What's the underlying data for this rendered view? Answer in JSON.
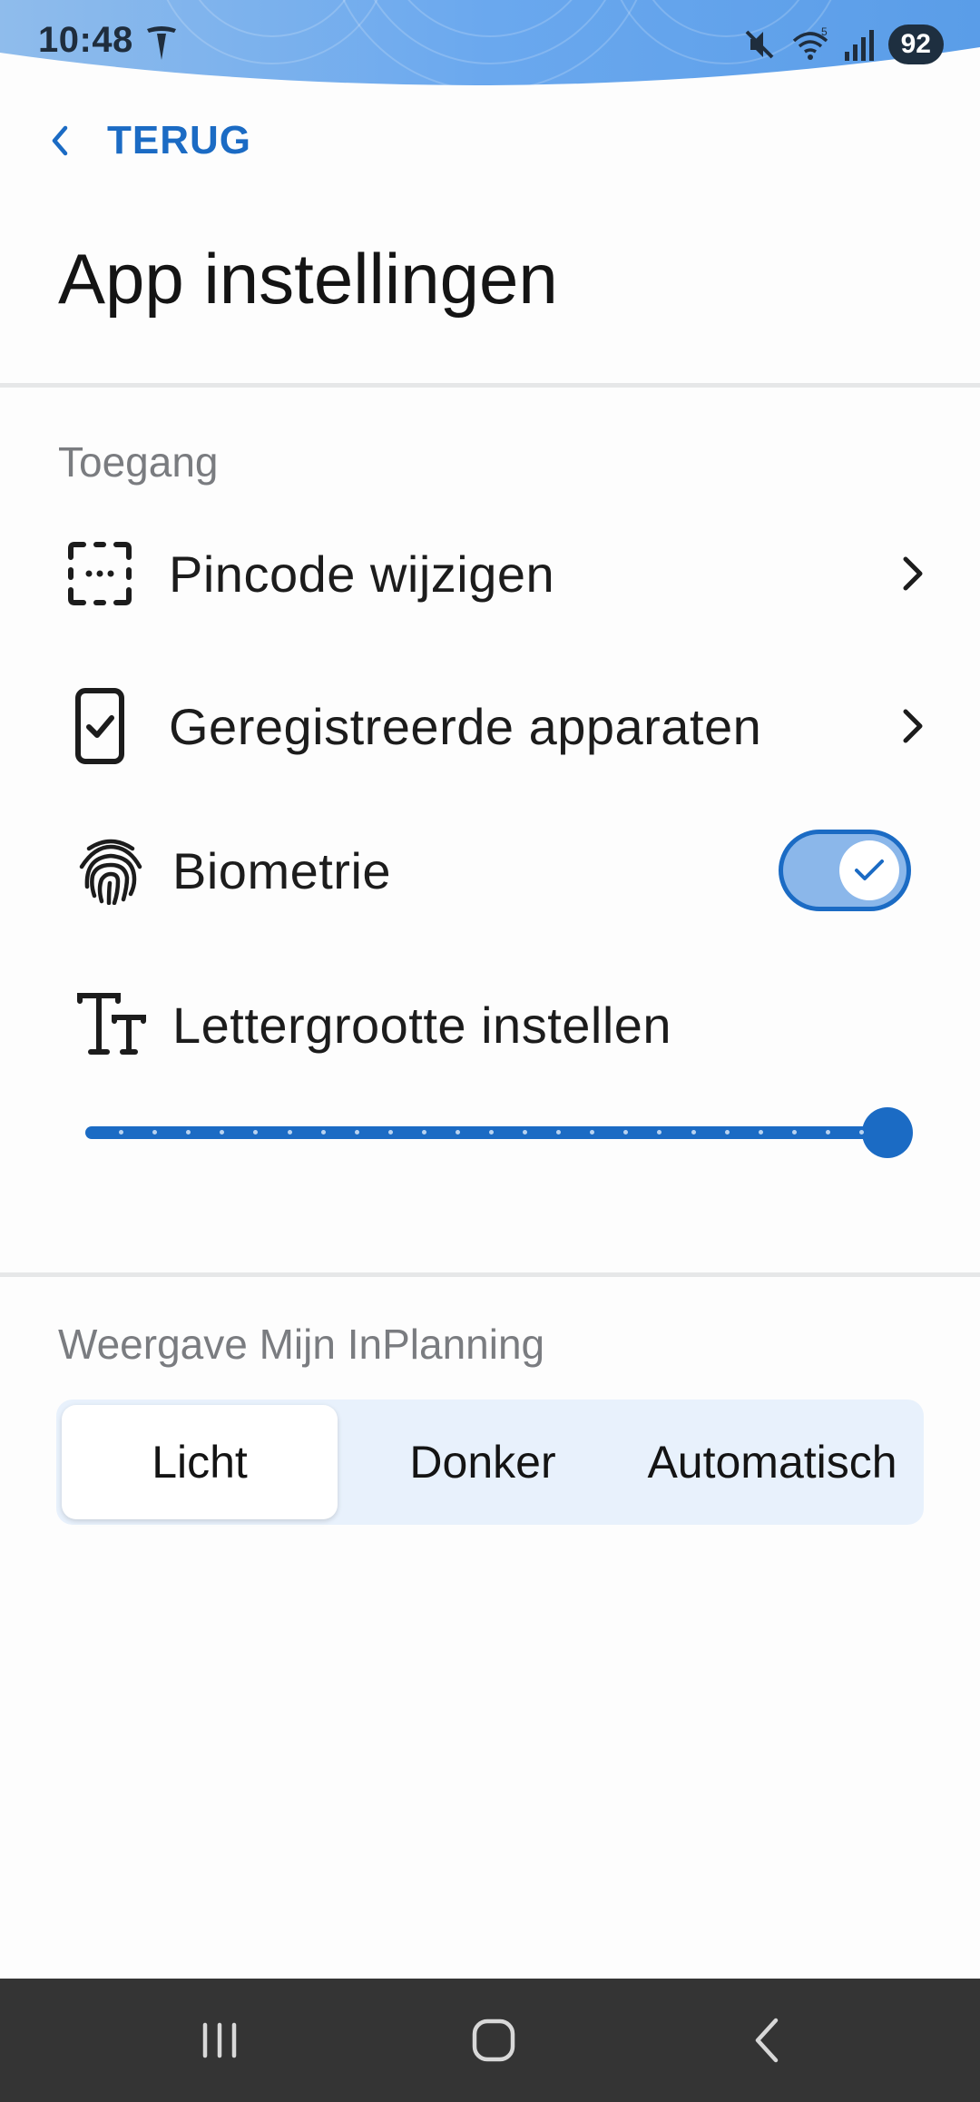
{
  "status_bar": {
    "time": "10:48",
    "battery": "92",
    "icons": [
      "tesla-icon",
      "mute-icon",
      "wifi-icon",
      "signal-icon"
    ]
  },
  "header": {
    "back_label": "TERUG",
    "title": "App instellingen"
  },
  "access": {
    "section_title": "Toegang",
    "items": [
      {
        "label": "Pincode wijzigen",
        "icon": "pincode-icon"
      },
      {
        "label": "Geregistreerde apparaten",
        "icon": "device-check-icon"
      },
      {
        "label": "Biometrie",
        "icon": "fingerprint-icon",
        "toggle_on": true
      },
      {
        "label": "Lettergrootte instellen",
        "icon": "text-size-icon"
      }
    ],
    "font_size_level": 1.0
  },
  "display": {
    "section_title": "Weergave Mijn InPlanning",
    "options": [
      "Licht",
      "Donker",
      "Automatisch"
    ],
    "selected": "Licht"
  },
  "colors": {
    "accent": "#1b6bc4",
    "toggle_track": "#8bb7ea",
    "segment_bg": "#e8f1fc",
    "navbar": "#343434"
  }
}
